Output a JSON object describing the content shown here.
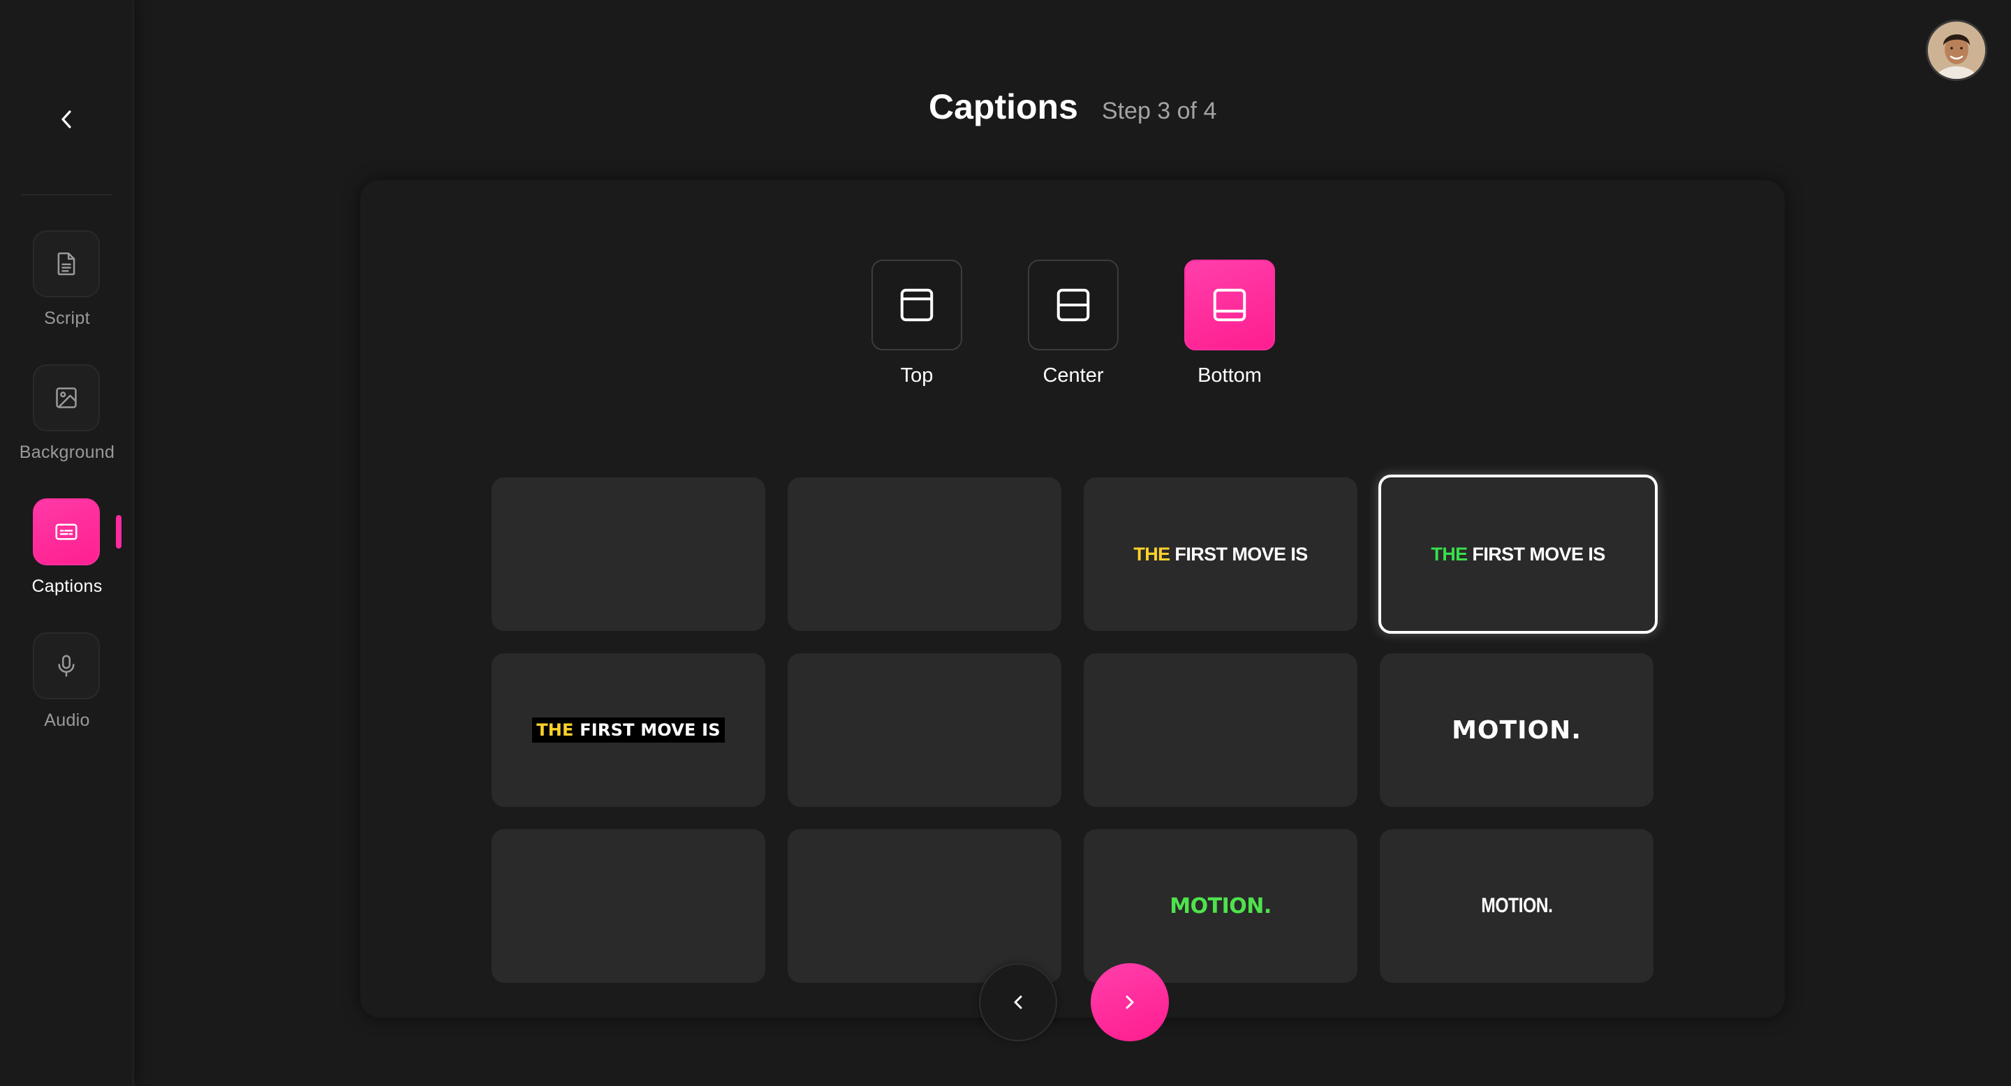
{
  "header": {
    "title": "Captions",
    "step": "Step 3 of 4"
  },
  "sidebar": {
    "back_icon": "chevron-left-icon",
    "items": [
      {
        "label": "Script",
        "icon": "document-icon",
        "active": false
      },
      {
        "label": "Background",
        "icon": "image-icon",
        "active": false
      },
      {
        "label": "Captions",
        "icon": "captions-icon",
        "active": true
      },
      {
        "label": "Audio",
        "icon": "microphone-icon",
        "active": false
      }
    ]
  },
  "positions": [
    {
      "label": "Top",
      "icon": "layout-top-icon",
      "selected": false
    },
    {
      "label": "Center",
      "icon": "layout-center-icon",
      "selected": false
    },
    {
      "label": "Bottom",
      "icon": "layout-bottom-icon",
      "selected": true
    }
  ],
  "styles": {
    "row1": [
      {
        "text": "",
        "selected": false
      },
      {
        "text": "",
        "selected": false
      },
      {
        "highlight": "THE",
        "rest": " FIRST MOVE IS",
        "highlight_color": "#ffd12a",
        "selected": false
      },
      {
        "highlight": "THE",
        "rest": " FIRST MOVE IS",
        "highlight_color": "#37e04a",
        "selected": true
      }
    ],
    "row2": [
      {
        "highlight": "THE",
        "rest": " FIRST MOVE IS",
        "highlight_color": "#ffd12a",
        "selected": false
      },
      {
        "text": "",
        "selected": false
      },
      {
        "text": "",
        "selected": false
      },
      {
        "text": "MOTION.",
        "selected": false
      }
    ],
    "row3": [
      {
        "text": "",
        "selected": false
      },
      {
        "text": "",
        "selected": false
      },
      {
        "text": "MOTION.",
        "color": "#4ee34c",
        "selected": false
      },
      {
        "text": "MOTION.",
        "selected": false
      }
    ]
  },
  "pagination": {
    "prev_icon": "chevron-left-icon",
    "next_icon": "chevron-right-icon"
  },
  "colors": {
    "accent": "#ff2fa0",
    "background": "#1a1a1a",
    "card": "#2a2a2a"
  },
  "user": {
    "avatar_icon": "user-avatar"
  }
}
